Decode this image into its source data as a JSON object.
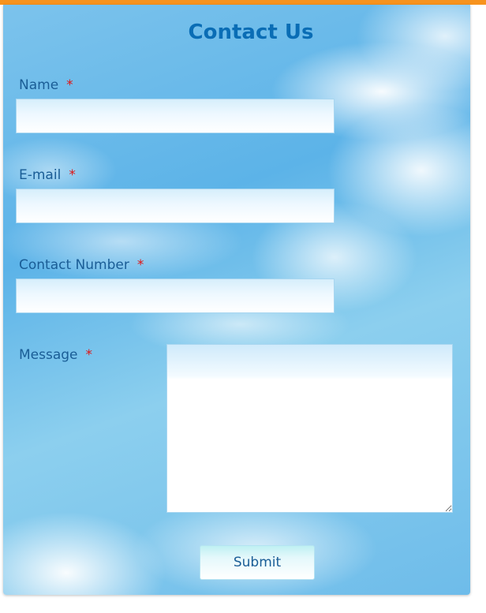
{
  "form": {
    "title": "Contact Us",
    "required_marker": "*",
    "fields": {
      "name": {
        "label": "Name",
        "value": ""
      },
      "email": {
        "label": "E-mail",
        "value": ""
      },
      "contact_number": {
        "label": "Contact Number",
        "value": ""
      },
      "message": {
        "label": "Message",
        "value": ""
      }
    },
    "submit_label": "Submit"
  },
  "colors": {
    "top_bar": "#f7931e",
    "title": "#0a6db5",
    "label": "#1a5d96",
    "required": "#e01414"
  }
}
